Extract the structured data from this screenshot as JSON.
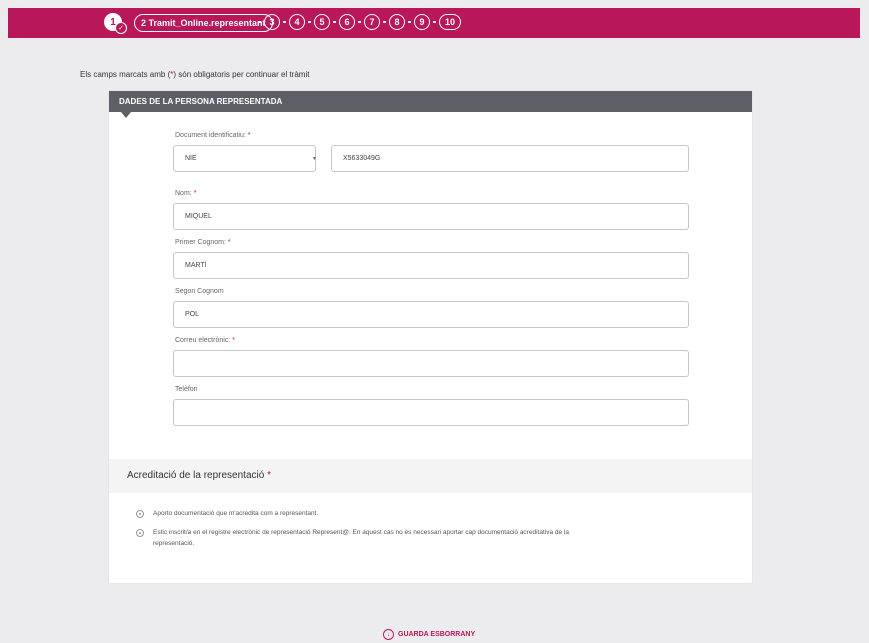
{
  "stepper": {
    "done_step": "1",
    "active_step": "2 Tramit_Online.representant",
    "steps": [
      "3",
      "4",
      "5",
      "6",
      "7",
      "8",
      "9",
      "10"
    ]
  },
  "intro": {
    "before": "Els camps marcats amb (",
    "mark": "*",
    "after": ") són obligatoris per continuar el tràmit"
  },
  "section": {
    "title": "DADES DE LA PERSONA REPRESENTADA"
  },
  "form": {
    "document": {
      "label": "Document identificatiu:",
      "type_value": "NIE",
      "number_value": "X5633049G"
    },
    "nom": {
      "label": "Nom:",
      "value": "MIQUEL"
    },
    "primer_cognom": {
      "label": "Primer Cognom:",
      "value": "MARTÍ"
    },
    "segon_cognom": {
      "label": "Segon Cognom",
      "value": "POL"
    },
    "correu": {
      "label": "Correu electrònic:",
      "value": ""
    },
    "telefon": {
      "label": "Telèfon",
      "value": ""
    }
  },
  "required_mark": "*",
  "acreditacio": {
    "title": "Acreditació de la representació",
    "options": [
      "Aporto documentació que m'acredita com a representant.",
      "Estic inscrit/a en el registre electrònic de representació Represent@. En aquest cas no és necessari aportar cap documentació acreditativa de la",
      "representació."
    ]
  },
  "actions": {
    "save_label": "GUARDA ESBORRANY"
  },
  "colors": {
    "brand": "#b8175a",
    "header": "#5d5e66",
    "required": "#c8102e"
  }
}
